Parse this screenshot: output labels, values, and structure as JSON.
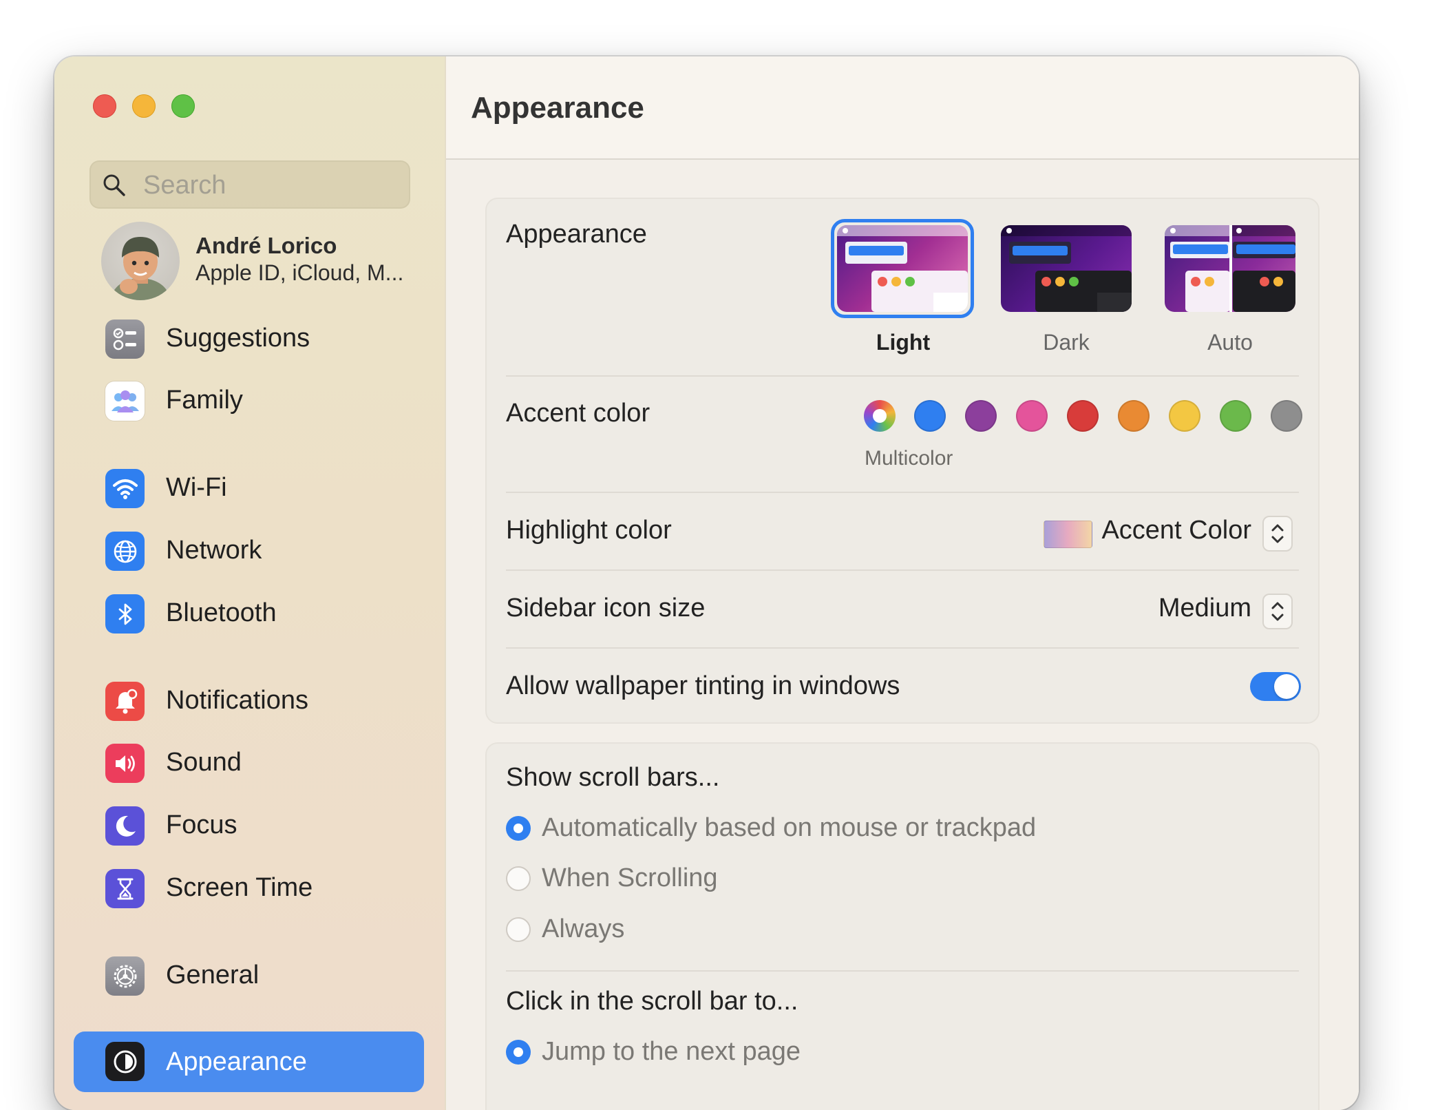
{
  "window": {
    "traffic_lights": {
      "close": "#ee5b52",
      "minimize": "#f5b63a",
      "zoom": "#5fc146"
    }
  },
  "sidebar": {
    "search": {
      "placeholder": "Search",
      "value": ""
    },
    "profile": {
      "name": "André Lorico",
      "subtitle": "Apple ID, iCloud, M..."
    },
    "items": [
      {
        "label": "Suggestions",
        "icon": "checklist-icon",
        "color": "#8e8e93"
      },
      {
        "label": "Family",
        "icon": "family-icon",
        "color": "#ffffff"
      },
      {
        "label": "Wi-Fi",
        "icon": "wifi-icon",
        "color": "#2f7ff0"
      },
      {
        "label": "Network",
        "icon": "globe-icon",
        "color": "#2f7ff0"
      },
      {
        "label": "Bluetooth",
        "icon": "bluetooth-icon",
        "color": "#2f7ff0"
      },
      {
        "label": "Notifications",
        "icon": "bell-icon",
        "color": "#ec4b46"
      },
      {
        "label": "Sound",
        "icon": "speaker-icon",
        "color": "#ec3d5c"
      },
      {
        "label": "Focus",
        "icon": "moon-icon",
        "color": "#5b51d8"
      },
      {
        "label": "Screen Time",
        "icon": "hourglass-icon",
        "color": "#5b51d8"
      },
      {
        "label": "General",
        "icon": "gear-icon",
        "color": "#8e8e93"
      },
      {
        "label": "Appearance",
        "icon": "appearance-icon",
        "color": "#1c1c1e",
        "selected": true
      }
    ],
    "selected_color": "#4a8cef"
  },
  "main": {
    "title": "Appearance",
    "appearance": {
      "label": "Appearance",
      "options": [
        {
          "label": "Light",
          "selected": true
        },
        {
          "label": "Dark",
          "selected": false
        },
        {
          "label": "Auto",
          "selected": false
        }
      ]
    },
    "accent": {
      "label": "Accent color",
      "selected_caption": "Multicolor",
      "swatches": [
        {
          "name": "Multicolor",
          "color": "multicolor",
          "selected": true
        },
        {
          "name": "Blue",
          "color": "#2f7ff0"
        },
        {
          "name": "Purple",
          "color": "#8c3f9c"
        },
        {
          "name": "Pink",
          "color": "#e4549b"
        },
        {
          "name": "Red",
          "color": "#d83c3a"
        },
        {
          "name": "Orange",
          "color": "#e98a33"
        },
        {
          "name": "Yellow",
          "color": "#f3c742"
        },
        {
          "name": "Green",
          "color": "#6bb94b"
        },
        {
          "name": "Graphite",
          "color": "#8e8e8e"
        }
      ]
    },
    "highlight": {
      "label": "Highlight color",
      "value": "Accent Color"
    },
    "sidebar_icon_size": {
      "label": "Sidebar icon size",
      "value": "Medium"
    },
    "wallpaper_tinting": {
      "label": "Allow wallpaper tinting in windows",
      "on": true
    },
    "scroll_bars": {
      "label": "Show scroll bars...",
      "options": [
        {
          "label": "Automatically based on mouse or trackpad",
          "selected": true
        },
        {
          "label": "When Scrolling",
          "selected": false
        },
        {
          "label": "Always",
          "selected": false
        }
      ]
    },
    "click_scroll": {
      "label": "Click in the scroll bar to...",
      "options": [
        {
          "label": "Jump to the next page",
          "selected": true
        }
      ]
    }
  }
}
